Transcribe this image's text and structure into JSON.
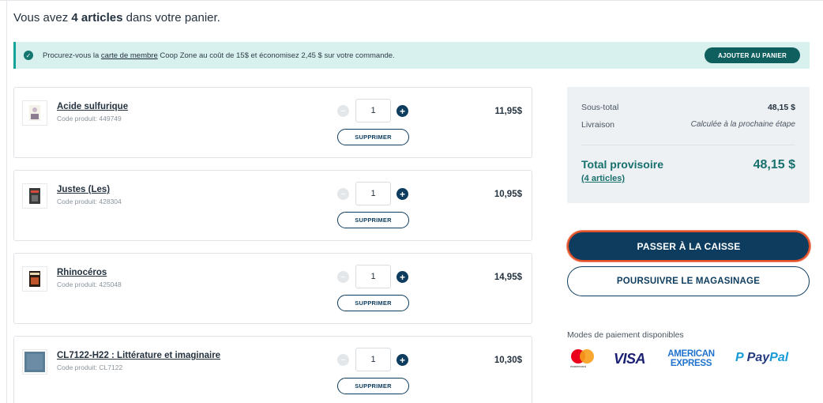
{
  "cart": {
    "title_prefix": "Vous avez ",
    "title_count": "4 articles",
    "title_suffix": " dans votre panier."
  },
  "promo": {
    "text_before": "Procurez-vous la ",
    "link": "carte de membre",
    "text_after": " Coop Zone au coût de 15$ et économisez 2,45 $ sur votre commande.",
    "button": "AJOUTER AU PANIER"
  },
  "items": [
    {
      "name": "Acide sulfurique",
      "code": "Code produit: 449749",
      "qty": "1",
      "price": "11,95$",
      "remove": "SUPPRIMER"
    },
    {
      "name": "Justes (Les)",
      "code": "Code produit: 428304",
      "qty": "1",
      "price": "10,95$",
      "remove": "SUPPRIMER"
    },
    {
      "name": "Rhinocéros",
      "code": "Code produit: 425048",
      "qty": "1",
      "price": "14,95$",
      "remove": "SUPPRIMER"
    },
    {
      "name": "CL7122-H22 : Littérature et imaginaire",
      "code": "Code produit: CL7122",
      "qty": "1",
      "price": "10,30$",
      "remove": "SUPPRIMER"
    }
  ],
  "summary": {
    "subtotal_label": "Sous-total",
    "subtotal_value": "48,15 $",
    "shipping_label": "Livraison",
    "shipping_value": "Calculée à la prochaine étape",
    "total_label": "Total provisoire",
    "total_count": "(4 articles)",
    "total_value": "48,15 $"
  },
  "actions": {
    "checkout": "PASSER À LA CAISSE",
    "continue": "POURSUIVRE LE MAGASINAGE"
  },
  "payment": {
    "title": "Modes de paiement disponibles",
    "logos": [
      "mastercard",
      "VISA",
      "AMERICAN EXPRESS",
      "PayPal"
    ],
    "mastercard_text": "mastercard",
    "visa_text": "VISA",
    "amex_line1": "AMERICAN",
    "amex_line2": "EXPRESS",
    "paypal_pay": "Pay",
    "paypal_pal": "Pal"
  },
  "colors": {
    "navy": "#0d3c5e",
    "teal": "#17706c",
    "promo_bg": "#d8f0ee",
    "checkout_outline": "#e2502a"
  }
}
